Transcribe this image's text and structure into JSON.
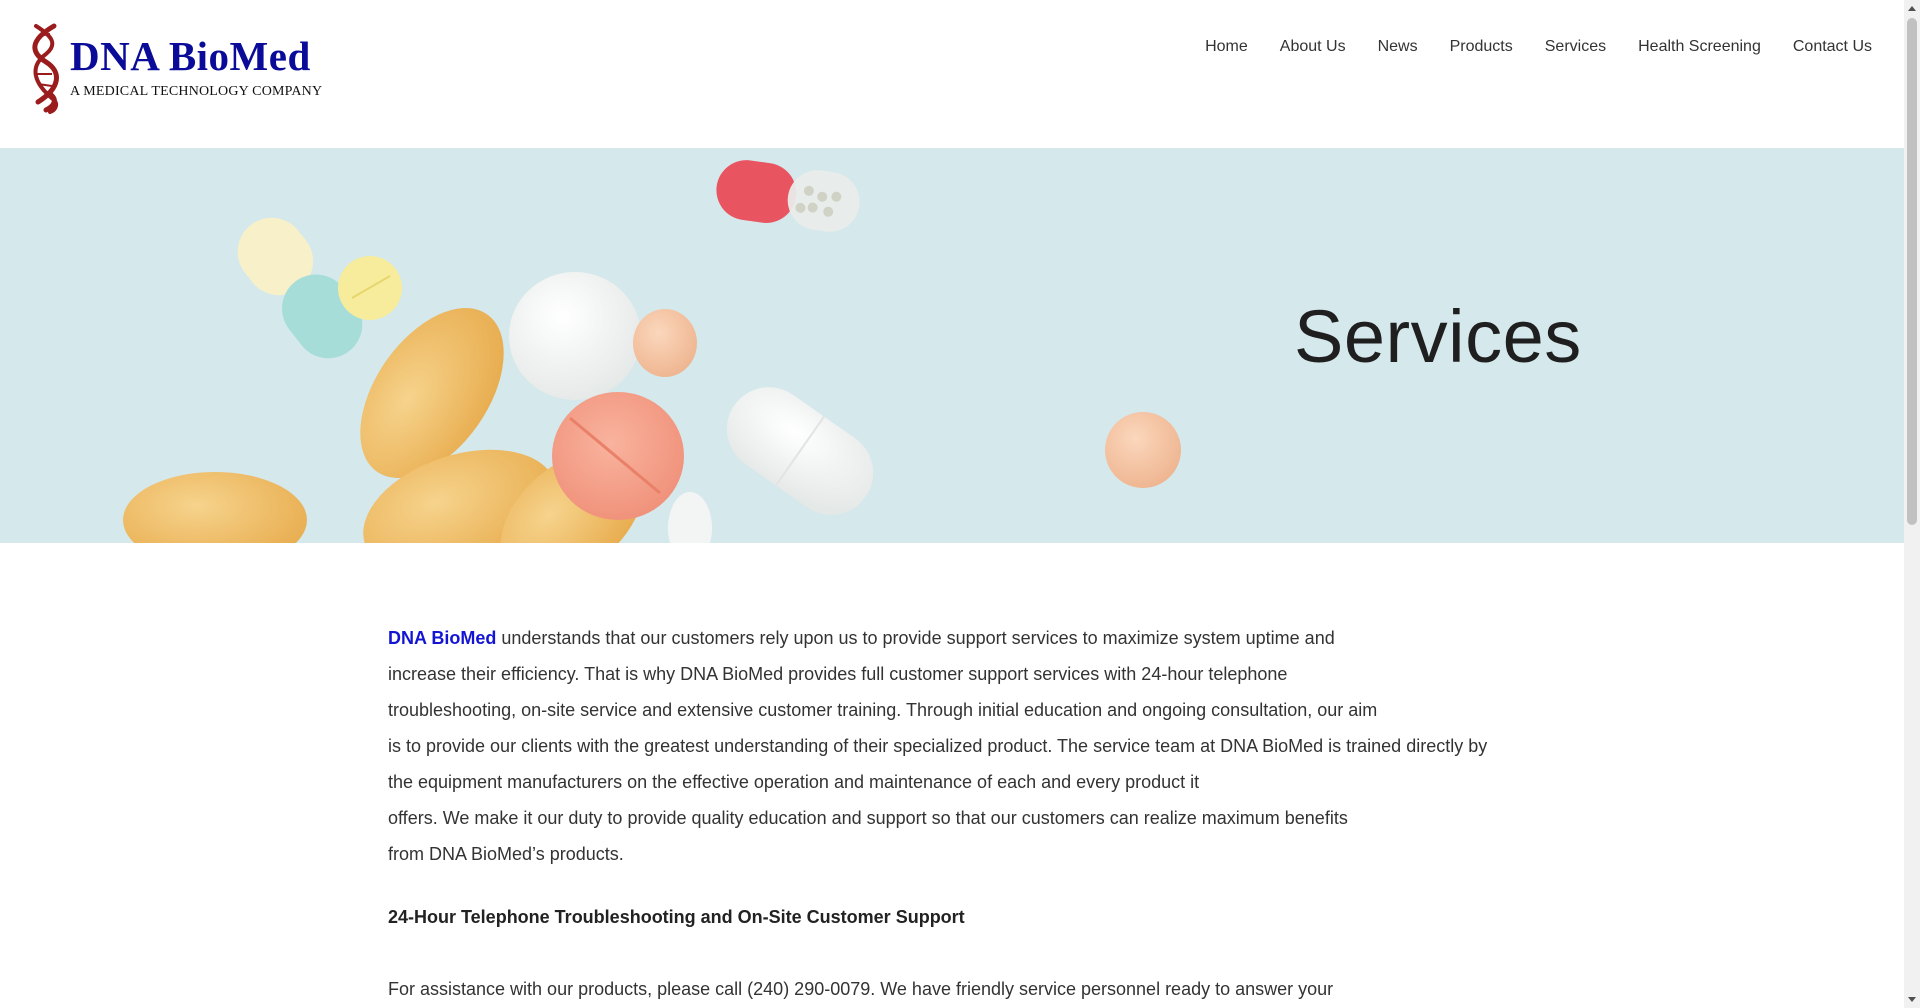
{
  "header": {
    "logo_title": "DNA BioMed",
    "logo_subtitle": "A MEDICAL TECHNOLOGY COMPANY",
    "logo_icon": "dna-helix-icon",
    "nav": [
      {
        "label": "Home"
      },
      {
        "label": "About Us"
      },
      {
        "label": "News"
      },
      {
        "label": "Products"
      },
      {
        "label": "Services"
      },
      {
        "label": "Health Screening"
      },
      {
        "label": "Contact Us"
      }
    ]
  },
  "hero": {
    "title": "Services",
    "image": "assorted-pills-photo"
  },
  "content": {
    "brand_link": "DNA BioMed",
    "intro_line_1_rest": " understands that our customers rely upon us to provide support services to maximize system uptime and",
    "intro_lines": [
      "increase their efficiency. That is why DNA BioMed provides full customer support services with 24-hour telephone",
      "troubleshooting, on-site service and extensive customer training. Through initial education and ongoing consultation, our aim",
      "is to provide our clients with the greatest understanding of their specialized product. The service team at DNA BioMed is trained directly by",
      "the equipment manufacturers on the effective operation and maintenance of each and every product it",
      "offers. We make it our duty to provide quality education and support so that our customers can realize maximum benefits",
      "from DNA BioMed’s products."
    ],
    "section_heading": "24-Hour Telephone Troubleshooting and On-Site Customer Support",
    "section_text": "For assistance with our products, please call (240) 290-0079. We have friendly service personnel ready to answer your"
  },
  "colors": {
    "brand_blue": "#0b0b9a",
    "link_blue": "#1414d4",
    "dna_red": "#9b1c1c",
    "hero_bg": "#d5e8ec"
  }
}
